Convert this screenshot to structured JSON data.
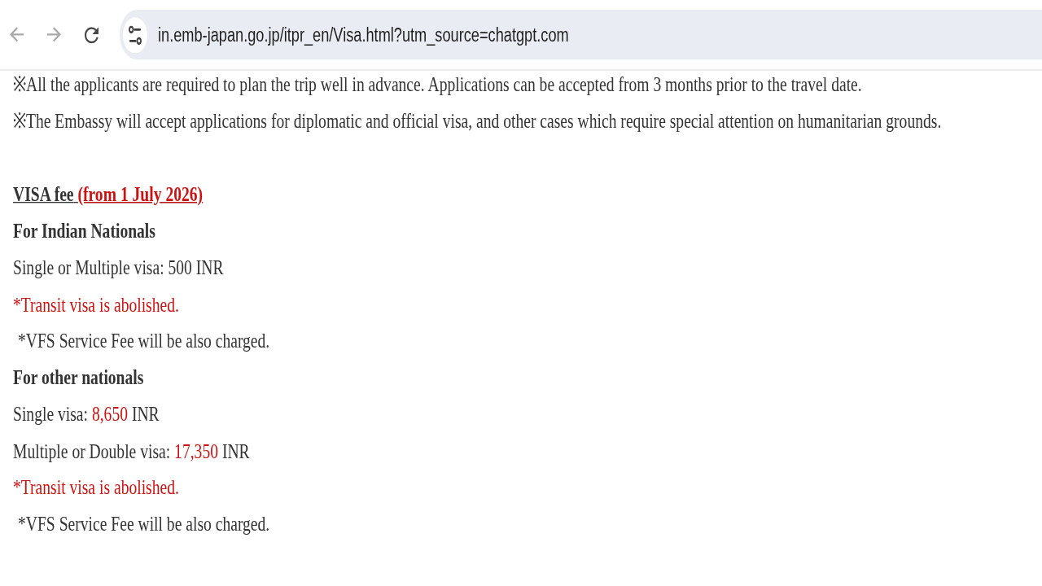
{
  "toolbar": {
    "back": {
      "disabled": true
    },
    "forward": {
      "disabled": true
    },
    "address_bar": {
      "url": "in.emb-japan.go.jp/itpr_en/Visa.html?utm_source=chatgpt.com"
    }
  },
  "notes": [
    "※All the applicants are required to plan the trip well in advance. Applications can be accepted from 3 months prior to the travel date.",
    "※The Embassy will accept applications for diplomatic and official visa, and other cases which require special attention on humanitarian grounds."
  ],
  "fee_section": {
    "heading": [
      {
        "text": "VISA fee",
        "highlighted": false
      },
      {
        "text": "(from 1 July 2026)",
        "highlighted": true
      }
    ],
    "groups": [
      {
        "heading": "For Indian Nationals",
        "lines": [
          {
            "kind": "line",
            "parts": [
              {
                "text": "Single or Multiple visa: 500 INR",
                "highlighted": false
              }
            ]
          },
          {
            "kind": "line",
            "parts": [
              {
                "text": "*Transit visa is abolished.",
                "highlighted": true
              }
            ]
          },
          {
            "kind": "footnote",
            "parts": [
              {
                "text": "*VFS Service Fee will be also charged.",
                "highlighted": false
              }
            ]
          }
        ]
      },
      {
        "heading": "For other nationals",
        "lines": [
          {
            "kind": "line",
            "parts": [
              {
                "text": "Single visa:",
                "highlighted": false
              },
              {
                "text": "8,650",
                "highlighted": true
              },
              {
                "text": "INR",
                "highlighted": false
              }
            ]
          },
          {
            "kind": "line",
            "parts": [
              {
                "text": "Multiple or Double visa:",
                "highlighted": false
              },
              {
                "text": "17,350",
                "highlighted": true
              },
              {
                "text": "INR",
                "highlighted": false
              }
            ]
          },
          {
            "kind": "line",
            "parts": [
              {
                "text": "*Transit visa is abolished.",
                "highlighted": true
              }
            ]
          },
          {
            "kind": "footnote",
            "parts": [
              {
                "text": "*VFS Service Fee will be also charged.",
                "highlighted": false
              }
            ]
          }
        ]
      }
    ]
  }
}
